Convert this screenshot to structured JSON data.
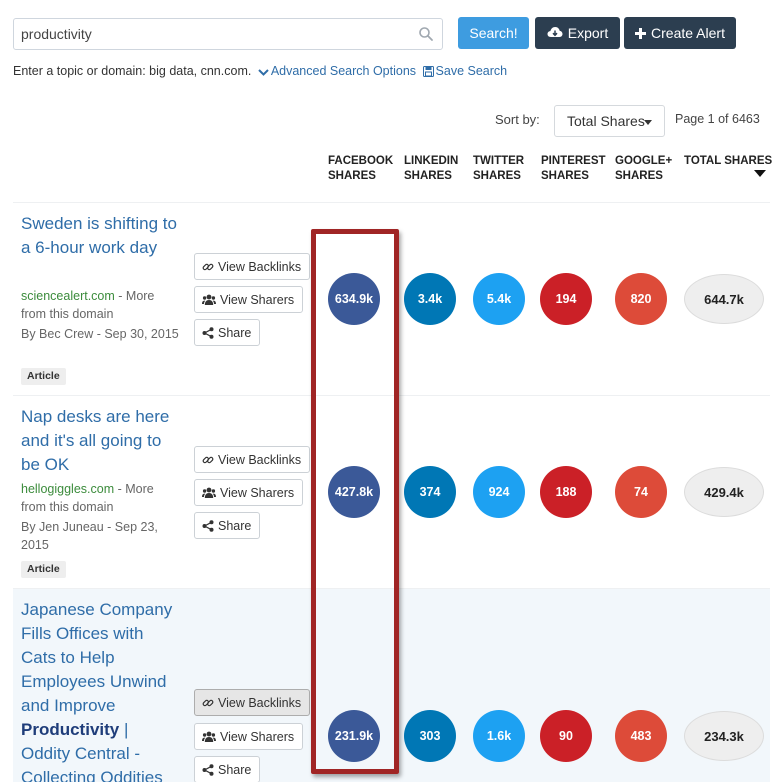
{
  "search": {
    "value": "productivity",
    "search_button": "Search!",
    "export_button": "Export",
    "alert_button": "Create Alert",
    "hint_text": "Enter a topic or domain: big data, cnn.com.",
    "advanced_link": "Advanced Search Options",
    "save_link": "Save Search"
  },
  "sort": {
    "label": "Sort by:",
    "selected": "Total Shares",
    "page_info": "Page 1 of 6463"
  },
  "columns": [
    {
      "line1": "FACEBOOK",
      "line2": "SHARES"
    },
    {
      "line1": "LINKEDIN",
      "line2": "SHARES"
    },
    {
      "line1": "TWITTER",
      "line2": "SHARES"
    },
    {
      "line1": "PINTEREST",
      "line2": "SHARES"
    },
    {
      "line1": "GOOGLE+",
      "line2": "SHARES"
    },
    {
      "line1": "TOTAL SHARES",
      "line2": ""
    }
  ],
  "actions": {
    "backlinks": "View Backlinks",
    "sharers": "View Sharers",
    "share": "Share"
  },
  "results": [
    {
      "title": "Sweden is shifting to a 6-hour work day",
      "domain": "sciencealert.com",
      "more": " - More from this domain",
      "byline": "By Bec Crew - Sep 30, 2015",
      "badge": "Article",
      "facebook": "634.9k",
      "linkedin": "3.4k",
      "twitter": "5.4k",
      "pinterest": "194",
      "googleplus": "820",
      "total": "644.7k"
    },
    {
      "title": "Nap desks are here and it's all going to be OK",
      "domain": "hellogiggles.com",
      "more": " - More from this domain",
      "byline": "By Jen Juneau - Sep 23, 2015",
      "badge": "Article",
      "facebook": "427.8k",
      "linkedin": "374",
      "twitter": "924",
      "pinterest": "188",
      "googleplus": "74",
      "total": "429.4k"
    },
    {
      "title_pre": "Japanese Company Fills Offices with Cats to Help Employees Unwind and Improve ",
      "title_bold": "Productivity",
      "title_post": " | Oddity Central - Collecting Oddities",
      "facebook": "231.9k",
      "linkedin": "303",
      "twitter": "1.6k",
      "pinterest": "90",
      "googleplus": "483",
      "total": "234.3k"
    }
  ]
}
